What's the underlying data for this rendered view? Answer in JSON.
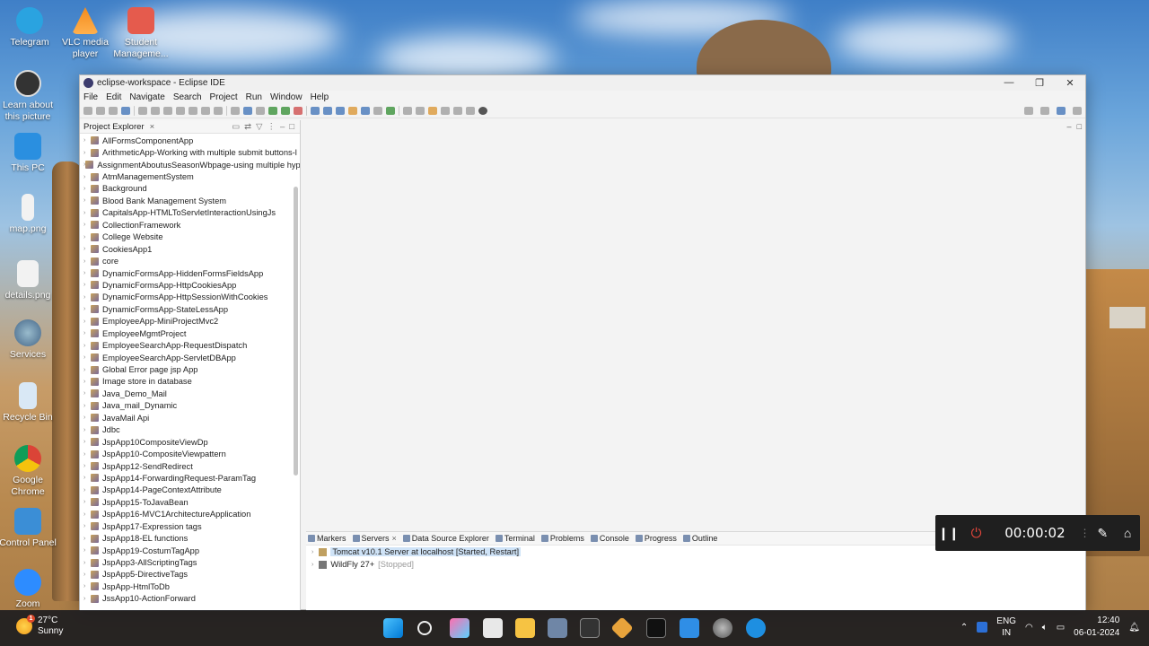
{
  "desktop": {
    "icons": [
      {
        "label": "Telegram"
      },
      {
        "label": "VLC media\nplayer"
      },
      {
        "label": "Student\nManageme..."
      },
      {
        "label": "Learn about\nthis picture"
      },
      {
        "label": "This PC"
      },
      {
        "label": "map.png"
      },
      {
        "label": "details.png"
      },
      {
        "label": "Services"
      },
      {
        "label": "Recycle Bin"
      },
      {
        "label": "Google\nChrome"
      },
      {
        "label": "Control Panel"
      },
      {
        "label": "Zoom"
      }
    ]
  },
  "window": {
    "title": "eclipse-workspace - Eclipse IDE",
    "controls": {
      "minimize": "—",
      "restore": "❐",
      "close": "✕"
    }
  },
  "menu": [
    "File",
    "Edit",
    "Navigate",
    "Search",
    "Project",
    "Run",
    "Window",
    "Help"
  ],
  "project_explorer": {
    "tab_label": "Project Explorer",
    "close": "×",
    "projects": [
      "AllFormsComponentApp",
      "ArithmeticApp-Working with multiple submit buttons-l",
      "AssignmentAboutusSeasonWbpage-using multiple hyp",
      "AtmManagementSystem",
      "Background",
      "Blood Bank Management System",
      "CapitalsApp-HTMLToServletInteractionUsingJs",
      "CollectionFramework",
      "College Website",
      "CookiesApp1",
      "core",
      "DynamicFormsApp-HiddenFormsFieldsApp",
      "DynamicFormsApp-HttpCookiesApp",
      "DynamicFormsApp-HttpSessionWithCookies",
      "DynamicFormsApp-StateLessApp",
      "EmployeeApp-MiniProjectMvc2",
      "EmployeeMgmtProject",
      "EmployeeSearchApp-RequestDispatch",
      "EmployeeSearchApp-ServletDBApp",
      "Global Error page jsp App",
      "Image store in database",
      "Java_Demo_Mail",
      "Java_mail_Dynamic",
      "JavaMail Api",
      "Jdbc",
      "JspApp10CompositeViewDp",
      "JspApp10-CompositeViewpattern",
      "JspApp12-SendRedirect",
      "JspApp14-ForwardingRequest-ParamTag",
      "JspApp14-PageContextAttribute",
      "JspApp15-ToJavaBean",
      "JspApp16-MVC1ArchitectureApplication",
      "JspApp17-Expression tags",
      "JspApp18-EL functions",
      " JspApp19-CostumTagApp",
      "JspApp3-AllScriptingTags",
      "JspApp5-DirectiveTags",
      "JspApp-HtmlToDb",
      "JssApp10-ActionForward"
    ]
  },
  "bottom_panel": {
    "tabs": [
      "Markers",
      "Servers",
      "Data Source Explorer",
      "Terminal",
      "Problems",
      "Console",
      "Progress",
      "Outline"
    ],
    "servers": [
      {
        "name": "Tomcat v10.1 Server at localhost",
        "status": "[Started, Restart]"
      },
      {
        "name": "WildFly 27+",
        "status": "[Stopped]"
      }
    ]
  },
  "recorder": {
    "time": "00:00:02",
    "pause": "❙❙",
    "stop": "⏻",
    "pen": "✎",
    "home": "⌂"
  },
  "taskbar": {
    "weather": {
      "temp": "27°C",
      "condition": "Sunny",
      "badge": "1"
    },
    "lang": {
      "line1": "ENG",
      "line2": "IN"
    },
    "clock": {
      "time": "12:40",
      "date": "06-01-2024"
    }
  }
}
